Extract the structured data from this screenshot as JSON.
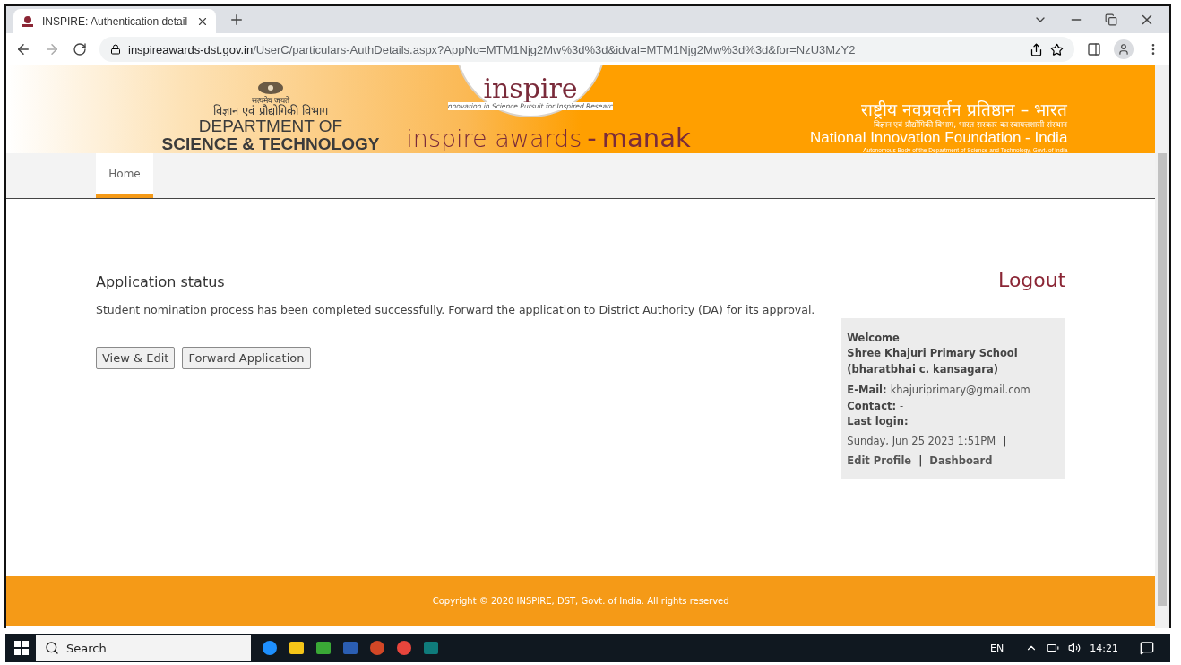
{
  "browser": {
    "tab_title": "INSPIRE: Authentication detail",
    "url_domain": "inspireawards-dst.gov.in",
    "url_path": "/UserC/particulars-AuthDetails.aspx?AppNo=MTM1Njg2Mw%3d%3d&idval=MTM1Njg2Mw%3d%3d&for=NzU3MzY2"
  },
  "banner": {
    "motto": "सत्यमेव जयते",
    "dept_hindi": "विज्ञान एवं प्रौद्योगिकी विभाग",
    "dept_line1": "DEPARTMENT OF",
    "dept_line2": "SCIENCE & TECHNOLOGY",
    "logo_word": "inspire",
    "logo_ring": "nnovation in Science Pursuit for Inspired Researc",
    "brand_left": "inspire awards",
    "brand_dash": "-",
    "brand_right": "manak",
    "nif_hindi": "राष्ट्रीय नवप्रवर्तन प्रतिष्ठान – भारत",
    "nif_hindi_sub": "विज्ञान एवं प्रौद्योगिकी विभाग, भारत सरकार का स्वायत्तशासी संस्थान",
    "nif_name": "National Innovation Foundation - India",
    "nif_sub": "Autonomous Body of the Department of Science and Technology, Govt. of India"
  },
  "nav": [
    {
      "label": "Home",
      "selected": true
    }
  ],
  "content": {
    "heading": "Application status",
    "message": "Student nomination process has been completed successfully. Forward the application to District Authority (DA) for its approval.",
    "buttons": [
      "View & Edit",
      "Forward Application"
    ]
  },
  "logout": "Logout",
  "profile": {
    "welcome": "Welcome",
    "school": "Shree Khajuri Primary School (bharatbhai c. kansagara)",
    "email_label": "E-Mail:",
    "email": "khajuriprimary@gmail.com",
    "contact_label": "Contact:",
    "contact": "-",
    "login_label": "Last login:",
    "login": "Sunday, Jun 25 2023 1:51PM",
    "sep": "|",
    "edit_profile": "Edit Profile",
    "dashboard": "Dashboard"
  },
  "footer": "Copyright © 2020 INSPIRE, DST, Govt. of India. All rights reserved",
  "taskbar": {
    "search": "Search",
    "lang": "EN",
    "time": "14:21"
  }
}
